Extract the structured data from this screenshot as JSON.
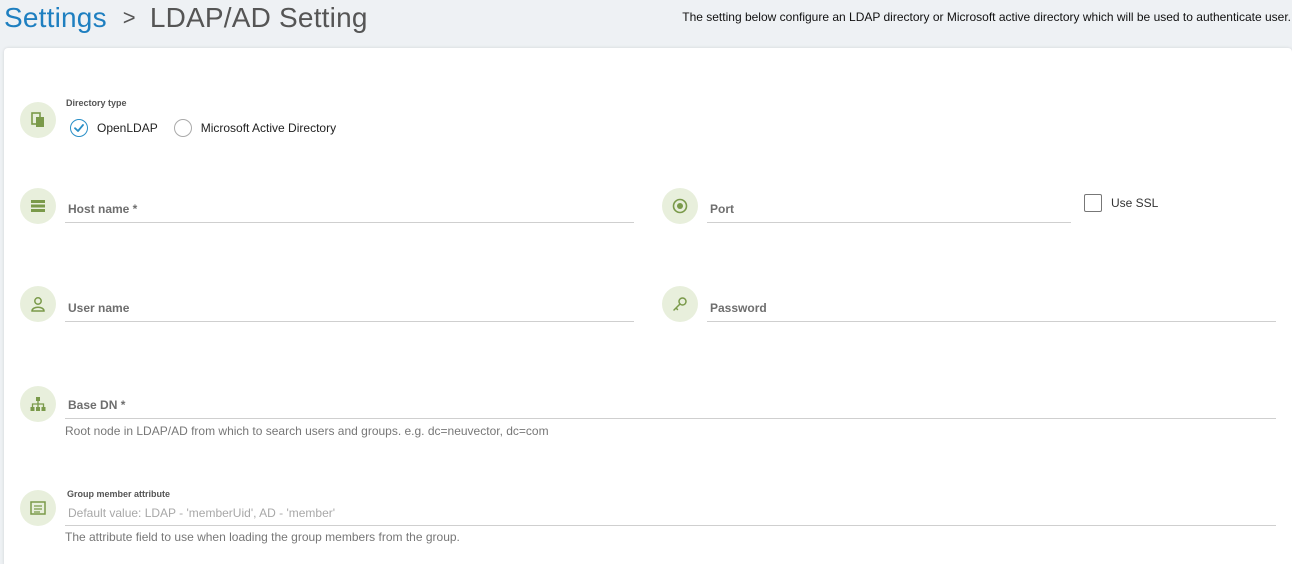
{
  "header": {
    "breadcrumb_root": "Settings",
    "breadcrumb_separator": ">",
    "breadcrumb_current": "LDAP/AD Setting",
    "description": "The setting below configure an LDAP directory or Microsoft active directory which will be used to authenticate user."
  },
  "directory_type": {
    "label": "Directory type",
    "options": [
      "OpenLDAP",
      "Microsoft Active Directory"
    ],
    "selected": "OpenLDAP"
  },
  "host": {
    "placeholder": "Host name *",
    "value": ""
  },
  "port": {
    "placeholder": "Port",
    "value": ""
  },
  "ssl": {
    "label": "Use SSL",
    "checked": false
  },
  "username": {
    "placeholder": "User name",
    "value": ""
  },
  "password": {
    "placeholder": "Password",
    "value": ""
  },
  "base_dn": {
    "placeholder": "Base DN *",
    "value": "",
    "hint": "Root node in LDAP/AD from which to search users and groups. e.g. dc=neuvector, dc=com"
  },
  "group_member": {
    "label": "Group member attribute",
    "placeholder": "Default value: LDAP - 'memberUid', AD - 'member'",
    "value": "",
    "hint": "The attribute field to use when loading the group members from the group."
  },
  "icons": {
    "directory": "document-copy-icon",
    "host": "server-icon",
    "port": "target-icon",
    "user": "person-icon",
    "password": "key-icon",
    "base_dn": "sitemap-icon",
    "group_member": "list-icon"
  },
  "colors": {
    "accent": "#1e7fc0",
    "icon_bg": "#e8efdc",
    "icon_fg": "#7a9a4a",
    "radio_check": "#2a8fc7"
  }
}
